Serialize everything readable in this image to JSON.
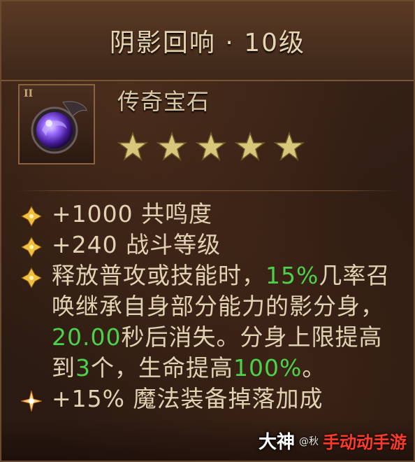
{
  "item": {
    "title": "阴影回响 · 10级",
    "type": "传奇宝石",
    "stars": 5,
    "stars_max": 5,
    "badge": "II"
  },
  "stats": [
    {
      "prefix": "+1000",
      "text": " 共鸣度"
    },
    {
      "prefix": "+240",
      "text": " 战斗等级"
    }
  ],
  "effect": {
    "part1": "释放普攻或技能时，",
    "pct": "15%",
    "part2": "几率召唤继承自身部分能力的影分身，",
    "duration": "20.00",
    "part3": "秒后消失。分身上限提高到",
    "count": "3",
    "part4": "个，生命提高",
    "hp": "100%",
    "part5": "。"
  },
  "bonus": {
    "prefix": "+15%",
    "text": " 魔法装备掉落加成"
  },
  "watermark": {
    "logo": "大神",
    "small": "@秋",
    "game": "手动动手游"
  },
  "colors": {
    "highlight": "#4cd24a",
    "text": "#e2d2b4",
    "star": "#d8c77a"
  }
}
